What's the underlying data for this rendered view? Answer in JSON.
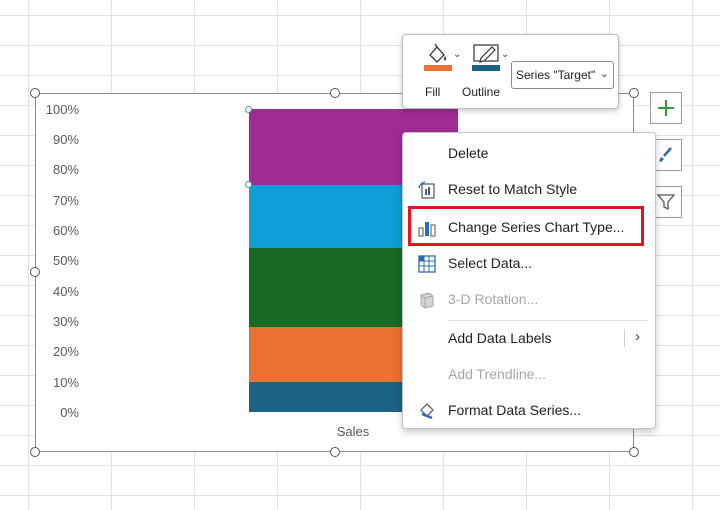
{
  "chart": {
    "y_ticks": [
      "100%",
      "90%",
      "80%",
      "70%",
      "60%",
      "50%",
      "40%",
      "30%",
      "20%",
      "10%",
      "0%"
    ],
    "x_label": "Sales",
    "segments": [
      {
        "name": "segment-1",
        "color": "#1b6384",
        "from": 0,
        "to": 10
      },
      {
        "name": "segment-2",
        "color": "#e97132",
        "from": 10,
        "to": 28
      },
      {
        "name": "segment-3",
        "color": "#196b24",
        "from": 28,
        "to": 54
      },
      {
        "name": "segment-4",
        "color": "#0f9ed5",
        "from": 54,
        "to": 75
      },
      {
        "name": "segment-target",
        "color": "#a02b93",
        "from": 75,
        "to": 100
      }
    ]
  },
  "mini_toolbar": {
    "fill_label": "Fill",
    "outline_label": "Outline",
    "series_select": "Series \"Target\"",
    "fill_color": "#e97132",
    "outline_color": "#1b6384"
  },
  "context_menu": {
    "items": [
      {
        "label": "Delete",
        "icon": "none",
        "disabled": false
      },
      {
        "label": "Reset to Match Style",
        "icon": "reset-style-icon",
        "disabled": false
      },
      {
        "label": "Change Series Chart Type...",
        "icon": "chart-type-icon",
        "disabled": false
      },
      {
        "label": "Select Data...",
        "icon": "select-data-icon",
        "disabled": false
      },
      {
        "label": "3-D Rotation...",
        "icon": "rotation-3d-icon",
        "disabled": true
      },
      {
        "label": "Add Data Labels",
        "icon": "none",
        "disabled": false
      },
      {
        "label": "Add Trendline...",
        "icon": "none",
        "disabled": true
      },
      {
        "label": "Format Data Series...",
        "icon": "format-series-icon",
        "disabled": false
      }
    ]
  },
  "colors": {
    "highlight": "#e3141f",
    "plus_green": "#3a9a3a"
  }
}
